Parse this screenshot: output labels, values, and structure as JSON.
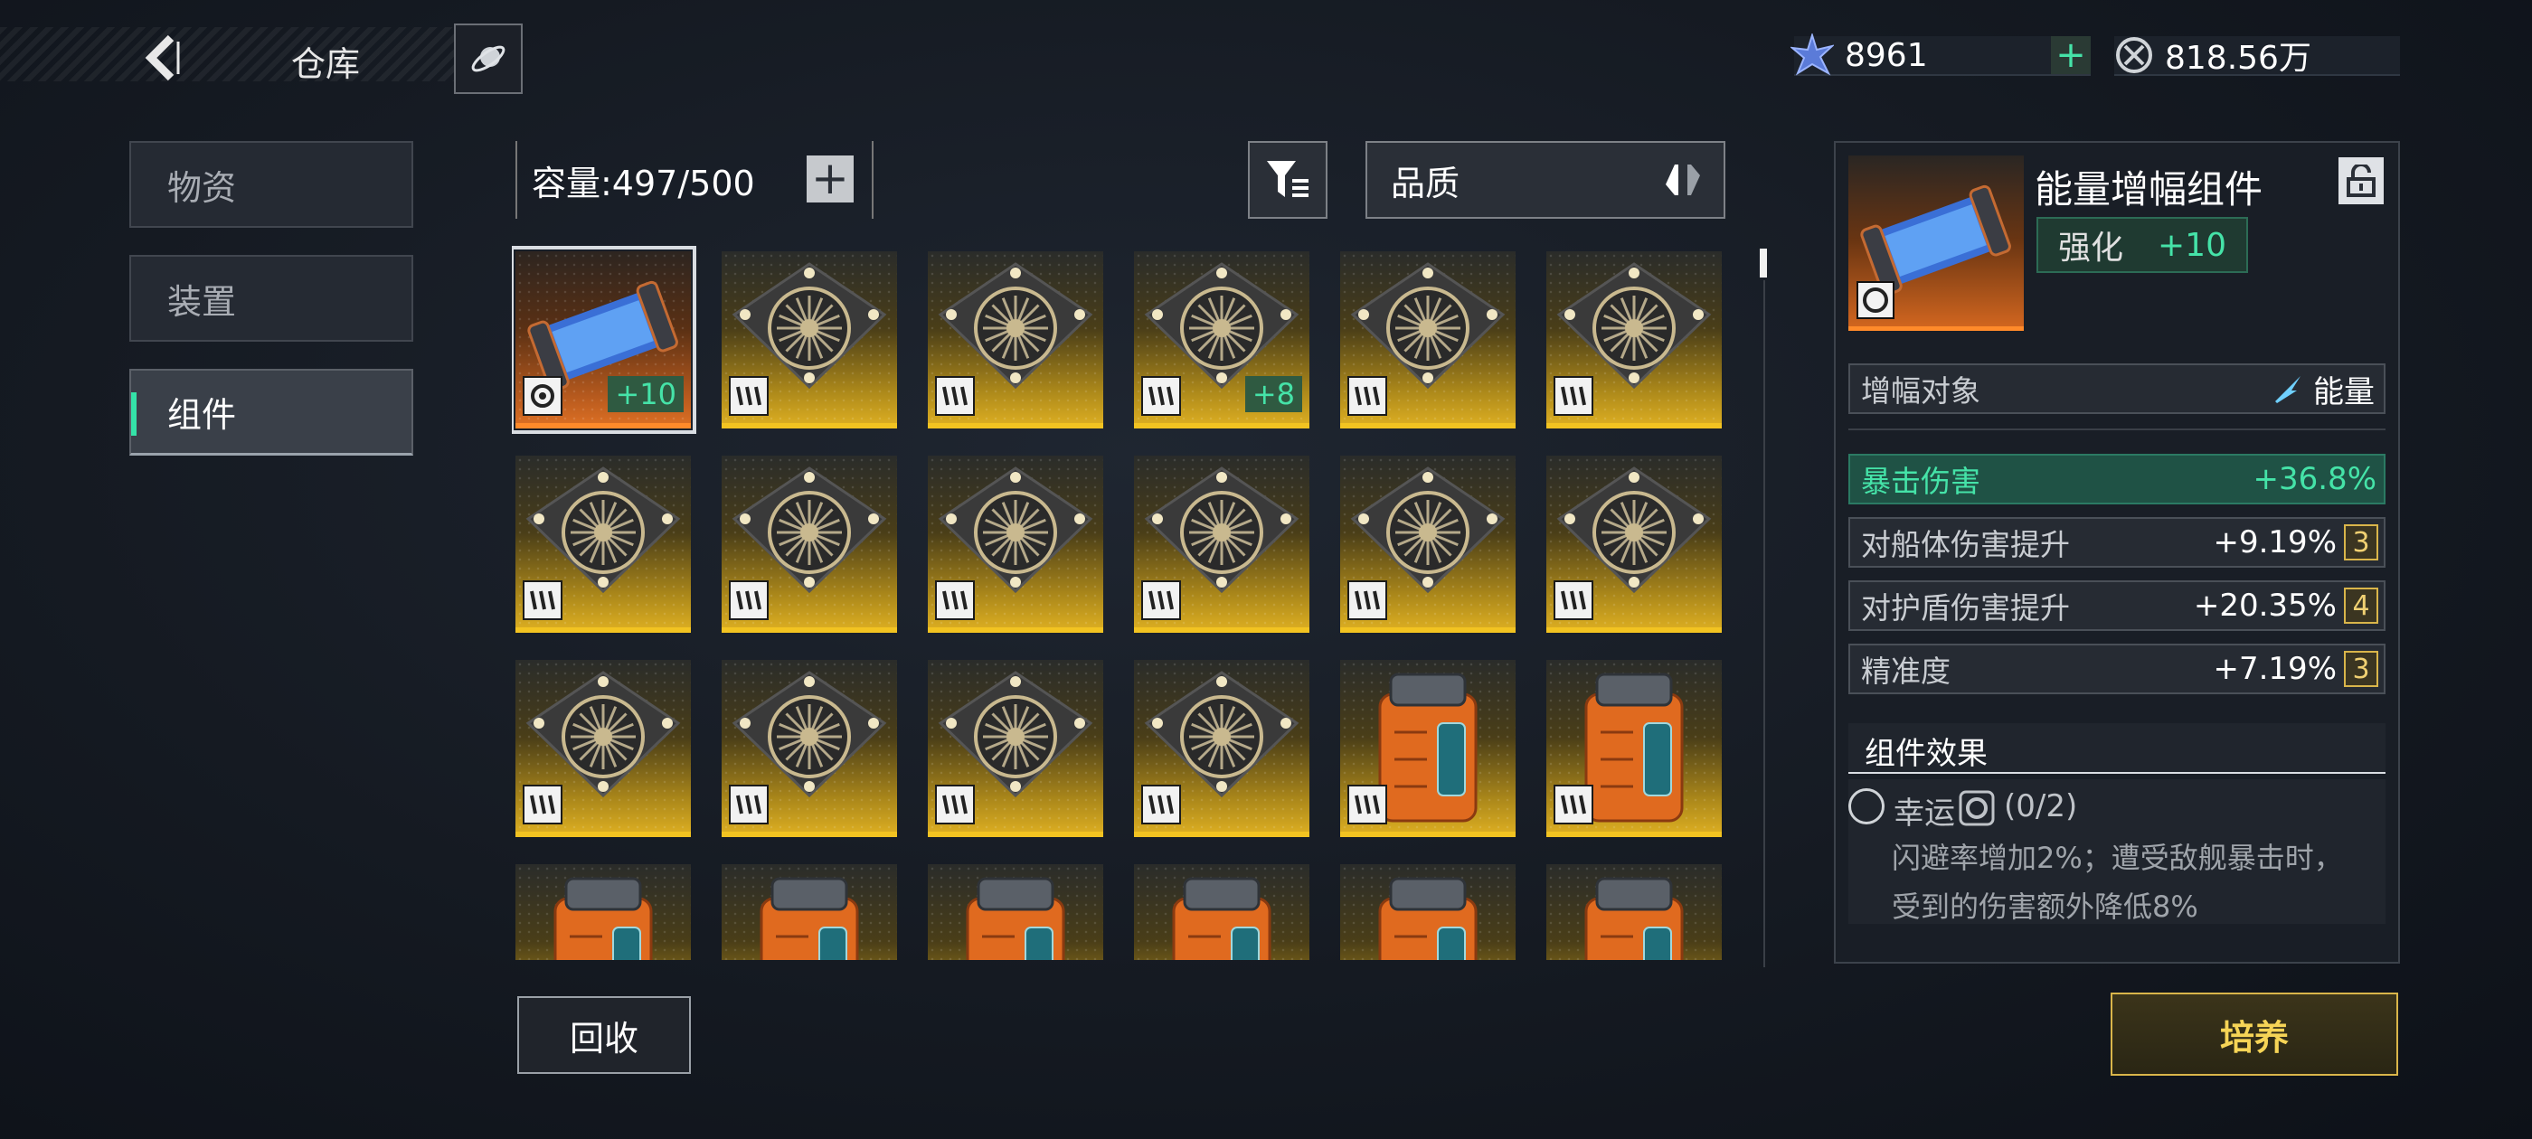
{
  "header": {
    "title": "仓库"
  },
  "currency": [
    {
      "icon": "crystal-icon",
      "value": "8961",
      "plus": "+"
    },
    {
      "icon": "coin-icon",
      "value": "818.56万"
    }
  ],
  "tabs": [
    {
      "label": "物资",
      "active": false
    },
    {
      "label": "装置",
      "active": false
    },
    {
      "label": "组件",
      "active": true
    }
  ],
  "inventory": {
    "capacity": "容量:497/500",
    "capacity_plus": "+",
    "sort_label": "品质",
    "items": [
      {
        "type": "energy-canister",
        "rarity": "orange",
        "level": "+10",
        "selected": true
      },
      {
        "type": "radial-module",
        "rarity": "gold",
        "level": ""
      },
      {
        "type": "radial-module",
        "rarity": "gold",
        "level": ""
      },
      {
        "type": "radial-module",
        "rarity": "gold",
        "level": "+8"
      },
      {
        "type": "radial-module",
        "rarity": "gold",
        "level": ""
      },
      {
        "type": "radial-module",
        "rarity": "gold",
        "level": ""
      },
      {
        "type": "radial-module",
        "rarity": "gold",
        "level": ""
      },
      {
        "type": "radial-module",
        "rarity": "gold",
        "level": ""
      },
      {
        "type": "radial-module",
        "rarity": "gold",
        "level": ""
      },
      {
        "type": "radial-module",
        "rarity": "gold",
        "level": ""
      },
      {
        "type": "radial-module",
        "rarity": "gold",
        "level": ""
      },
      {
        "type": "radial-module",
        "rarity": "gold",
        "level": ""
      },
      {
        "type": "radial-module",
        "rarity": "gold",
        "level": ""
      },
      {
        "type": "radial-module",
        "rarity": "gold",
        "level": ""
      },
      {
        "type": "radial-module",
        "rarity": "gold",
        "level": ""
      },
      {
        "type": "radial-module",
        "rarity": "gold",
        "level": ""
      },
      {
        "type": "orange-capsule",
        "rarity": "gold",
        "level": ""
      },
      {
        "type": "orange-capsule",
        "rarity": "gold",
        "level": ""
      },
      {
        "type": "orange-capsule",
        "rarity": "gold",
        "level": ""
      },
      {
        "type": "orange-capsule",
        "rarity": "gold",
        "level": ""
      },
      {
        "type": "orange-capsule",
        "rarity": "gold",
        "level": ""
      },
      {
        "type": "orange-capsule",
        "rarity": "gold",
        "level": ""
      },
      {
        "type": "orange-capsule",
        "rarity": "gold",
        "level": ""
      },
      {
        "type": "orange-capsule",
        "rarity": "gold",
        "level": ""
      }
    ]
  },
  "actions": {
    "recycle": "回收",
    "cultivate": "培养"
  },
  "detail": {
    "name": "能量增幅组件",
    "enhance_label": "强化",
    "enhance_value": "+10",
    "target_label": "增幅对象",
    "target_value": "能量",
    "main_stat": {
      "label": "暴击伤害",
      "value": "+36.8%"
    },
    "sub_stats": [
      {
        "label": "对船体伤害提升",
        "value": "+9.19%",
        "badge": "3"
      },
      {
        "label": "对护盾伤害提升",
        "value": "+20.35%",
        "badge": "4"
      },
      {
        "label": "精准度",
        "value": "+7.19%",
        "badge": "3"
      }
    ],
    "effect_title": "组件效果",
    "effect_name": "幸运",
    "effect_count": "(0/2)",
    "effect_desc": "闪避率增加2%；遭受敌舰暴击时，受到的伤害额外降低8%"
  },
  "colors": {
    "accent": "#45e3a8",
    "gold": "#f2c321",
    "orange": "#ff8a2a",
    "cultivate": "#f6d456"
  }
}
